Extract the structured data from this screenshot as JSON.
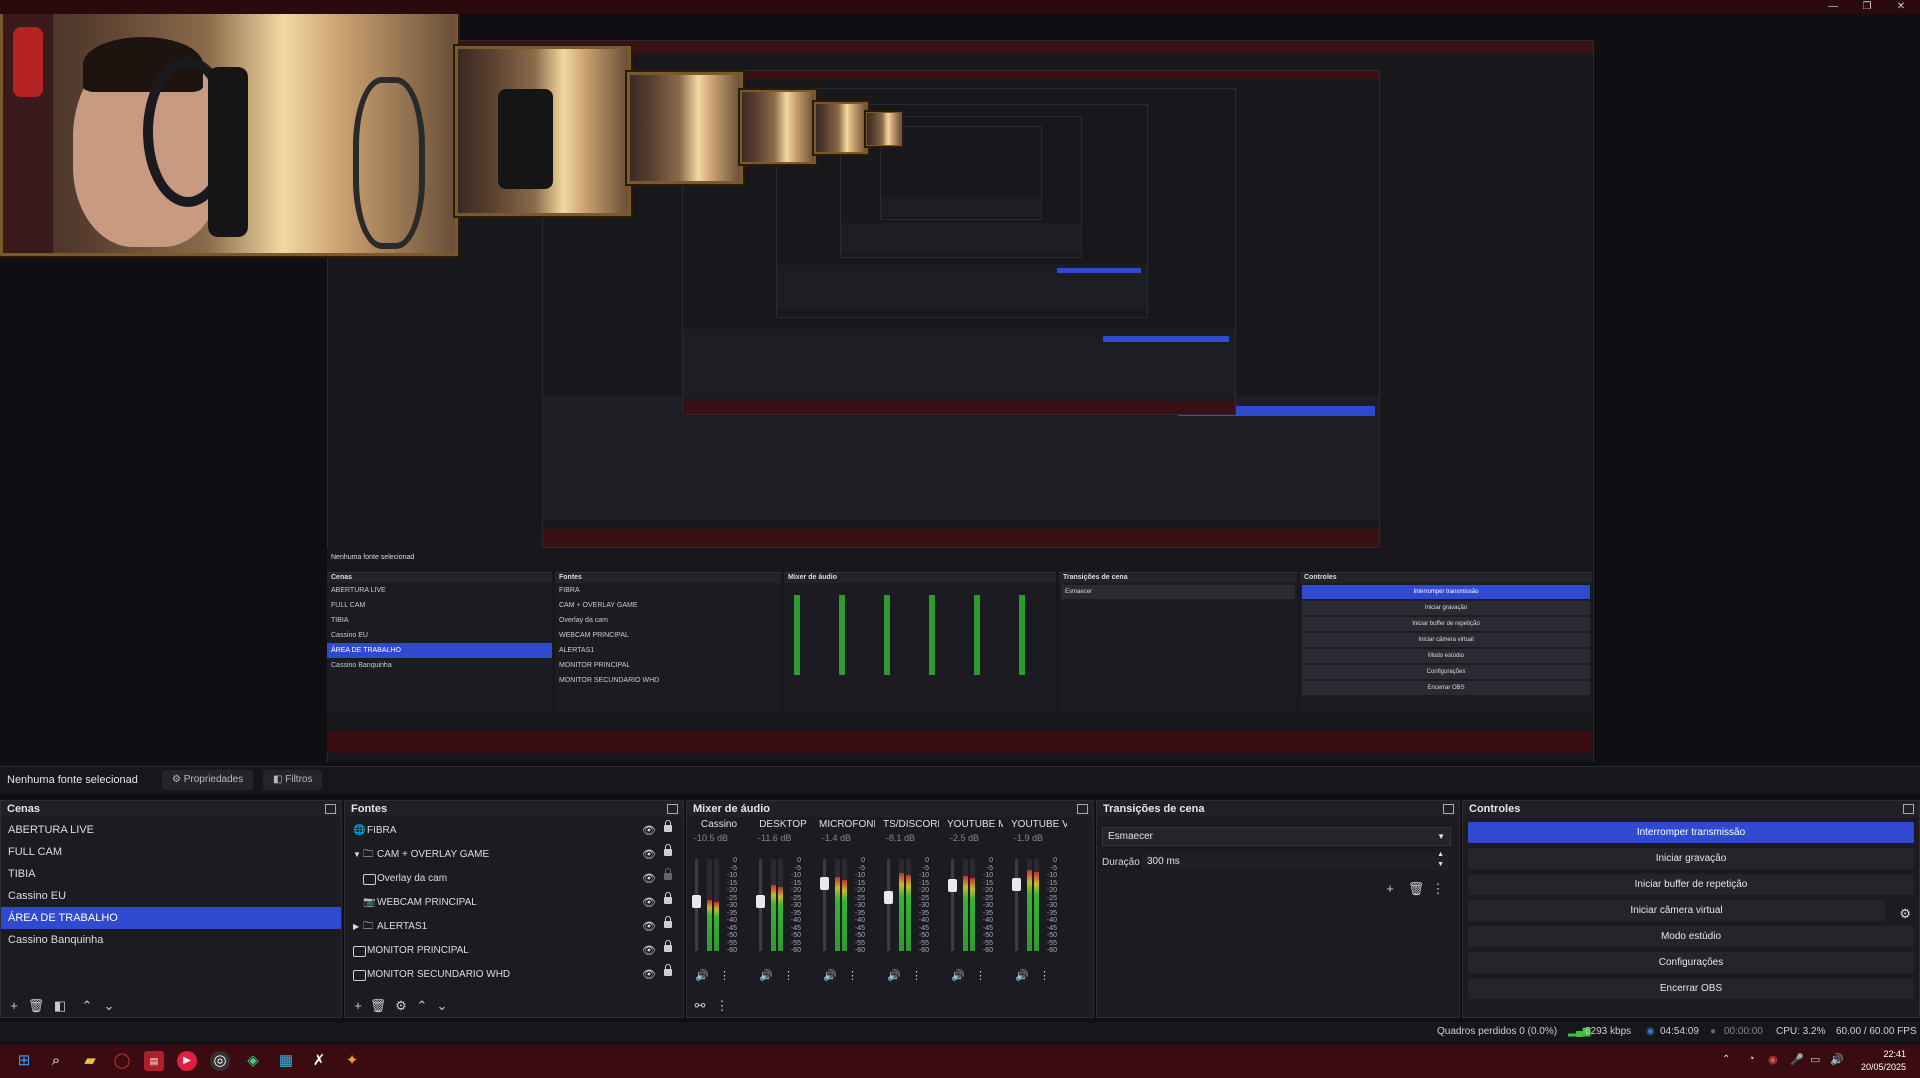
{
  "window": {
    "minimize": "—",
    "maximize": "❐",
    "close": "✕"
  },
  "topbar": {
    "no_source": "Nenhuma fonte selecionad",
    "properties": "Propriedades",
    "filters": "Filtros"
  },
  "scenes": {
    "title": "Cenas",
    "items": [
      "ABERTURA LIVE",
      "FULL CAM",
      "TIBIA",
      "Cassino EU",
      "ÁREA DE TRABALHO",
      "Cassino Banquinha"
    ],
    "selected": "ÁREA DE TRABALHO"
  },
  "sources": {
    "title": "Fontes",
    "items": [
      {
        "label": "FIBRA",
        "icon": "globe-icon"
      },
      {
        "label": "CAM + OVERLAY GAME",
        "icon": "folder-icon"
      },
      {
        "label": "Overlay da cam",
        "icon": "image-icon"
      },
      {
        "label": "WEBCAM PRINCIPAL",
        "icon": "camera-icon"
      },
      {
        "label": "ALERTAS1",
        "icon": "folder-icon"
      },
      {
        "label": "MONITOR PRINCIPAL",
        "icon": "monitor-icon"
      },
      {
        "label": "MONITOR SECUNDARIO WHD",
        "icon": "monitor-icon"
      }
    ]
  },
  "mixer": {
    "title": "Mixer de áudio",
    "channels": [
      {
        "name": "Cassino",
        "db": "-10.5 dB",
        "level": 0.55,
        "fader": 0.55
      },
      {
        "name": "DESKTOP",
        "db": "-11.6 dB",
        "level": 0.72,
        "fader": 0.55
      },
      {
        "name": "MICROFONE",
        "db": "-1.4 dB",
        "level": 0.8,
        "fader": 0.78
      },
      {
        "name": "TS/DISCORD",
        "db": "-8.1 dB",
        "level": 0.85,
        "fader": 0.6
      },
      {
        "name": "YOUTUBE MUSIC",
        "db": "-2.5 dB",
        "level": 0.82,
        "fader": 0.75
      },
      {
        "name": "YOUTUBE VIDEO",
        "db": "-1.9 dB",
        "level": 0.88,
        "fader": 0.76
      }
    ],
    "scale": [
      "0",
      "-5",
      "-10",
      "-15",
      "-20",
      "-25",
      "-30",
      "-35",
      "-40",
      "-45",
      "-50",
      "-55",
      "-60"
    ]
  },
  "transitions": {
    "title": "Transições de cena",
    "selected": "Esmaecer",
    "duration_label": "Duração",
    "duration_value": "300 ms"
  },
  "controls": {
    "title": "Controles",
    "stop_stream": "Interromper transmissão",
    "start_recording": "Iniciar gravação",
    "start_replay": "Iniciar buffer de repetição",
    "start_virtualcam": "Iniciar câmera virtual",
    "studio_mode": "Modo estúdio",
    "settings": "Configurações",
    "exit": "Encerrar OBS"
  },
  "status": {
    "dropped": "Quadros perdidos 0 (0.0%)",
    "bitrate": "6293 kbps",
    "live_time": "04:54:09",
    "rec_time": "00:00:00",
    "cpu": "CPU: 3.2%",
    "fps": "60.00 / 60.00 FPS"
  },
  "taskbar": {
    "time": "22:41",
    "date": "20/05/2025"
  },
  "colors": {
    "accent": "#2f4ad0",
    "taskbar": "#3a0b10",
    "panel": "#1b1b21"
  }
}
